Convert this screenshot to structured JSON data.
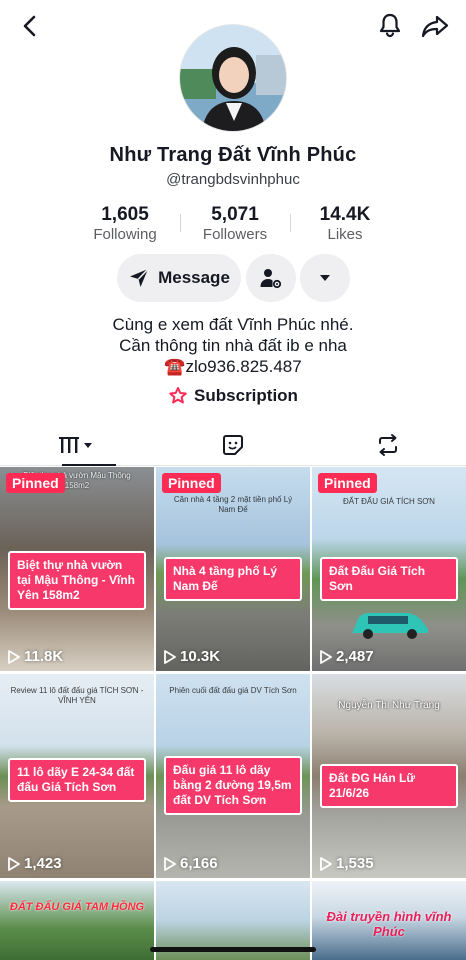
{
  "profile": {
    "name": "Như Trang Đất Vĩnh Phúc",
    "handle": "@trangbdsvinhphuc",
    "stats": [
      {
        "value": "1,605",
        "label": "Following"
      },
      {
        "value": "5,071",
        "label": "Followers"
      },
      {
        "value": "14.4K",
        "label": "Likes"
      }
    ],
    "message_label": "Message",
    "bio": [
      "Cùng e xem đất Vĩnh Phúc nhé.",
      "Cần thông tin nhà đất ib e nha",
      "☎️zlo936.825.487"
    ],
    "subscription_label": "Subscription"
  },
  "icons": {
    "back": "back-chevron-icon",
    "bell": "bell-icon",
    "share": "share-icon",
    "message": "send-icon",
    "add_user": "user-settings-icon",
    "more": "caret-down-icon",
    "subscription": "star-heart-icon",
    "tab_videos": "grid-icon",
    "tab_favorites": "sticker-icon",
    "tab_reposts": "repost-icon"
  },
  "colors": {
    "pinned": "#fe2c55",
    "caption": "#f6396a",
    "button_bg": "#efeff1"
  },
  "videos": [
    {
      "pinned": "Pinned",
      "caption": "Biệt thự nhà vườn tại Mậu Thông - Vĩnh Yên 158m2",
      "views": "11.8K",
      "small_text": "Biệt thự nhà vườn Mậu Thông 158m2"
    },
    {
      "pinned": "Pinned",
      "caption": "Nhà 4 tầng phố Lý Nam Đế",
      "views": "10.3K",
      "small_text": "Căn nhà 4 tầng 2 mặt tiền phố Lý Nam Đế"
    },
    {
      "pinned": "Pinned",
      "caption": "Đất Đấu Giá Tích Sơn",
      "views": "2,487",
      "small_text": "ĐẤT ĐẤU GIÁ TÍCH SƠN"
    },
    {
      "pinned": "",
      "caption": "11 lô dãy E 24-34 đất đấu Giá Tích Sơn",
      "views": "1,423",
      "small_text": "Review 11 lô đất đấu giá TÍCH SƠN - VĨNH YÊN"
    },
    {
      "pinned": "",
      "caption": "Đấu giá 11 lô dãy bằng 2 đường 19,5m đất DV Tích Sơn",
      "views": "6,166",
      "small_text": "Phiên cuối đất đấu giá DV Tích Sơn"
    },
    {
      "pinned": "",
      "caption": "Đất ĐG Hán Lữ 21/6/26",
      "views": "1,535",
      "small_text": "Nguyễn Thị Như Trang"
    },
    {
      "pinned": "",
      "caption": "",
      "views": "",
      "small_text": "ĐẤT ĐẤU GIÁ TAM HỒNG"
    },
    {
      "pinned": "",
      "caption": "",
      "views": "",
      "small_text": ""
    },
    {
      "pinned": "",
      "caption": "",
      "views": "",
      "small_text": "Đài truyền hình vĩnh Phúc"
    }
  ]
}
